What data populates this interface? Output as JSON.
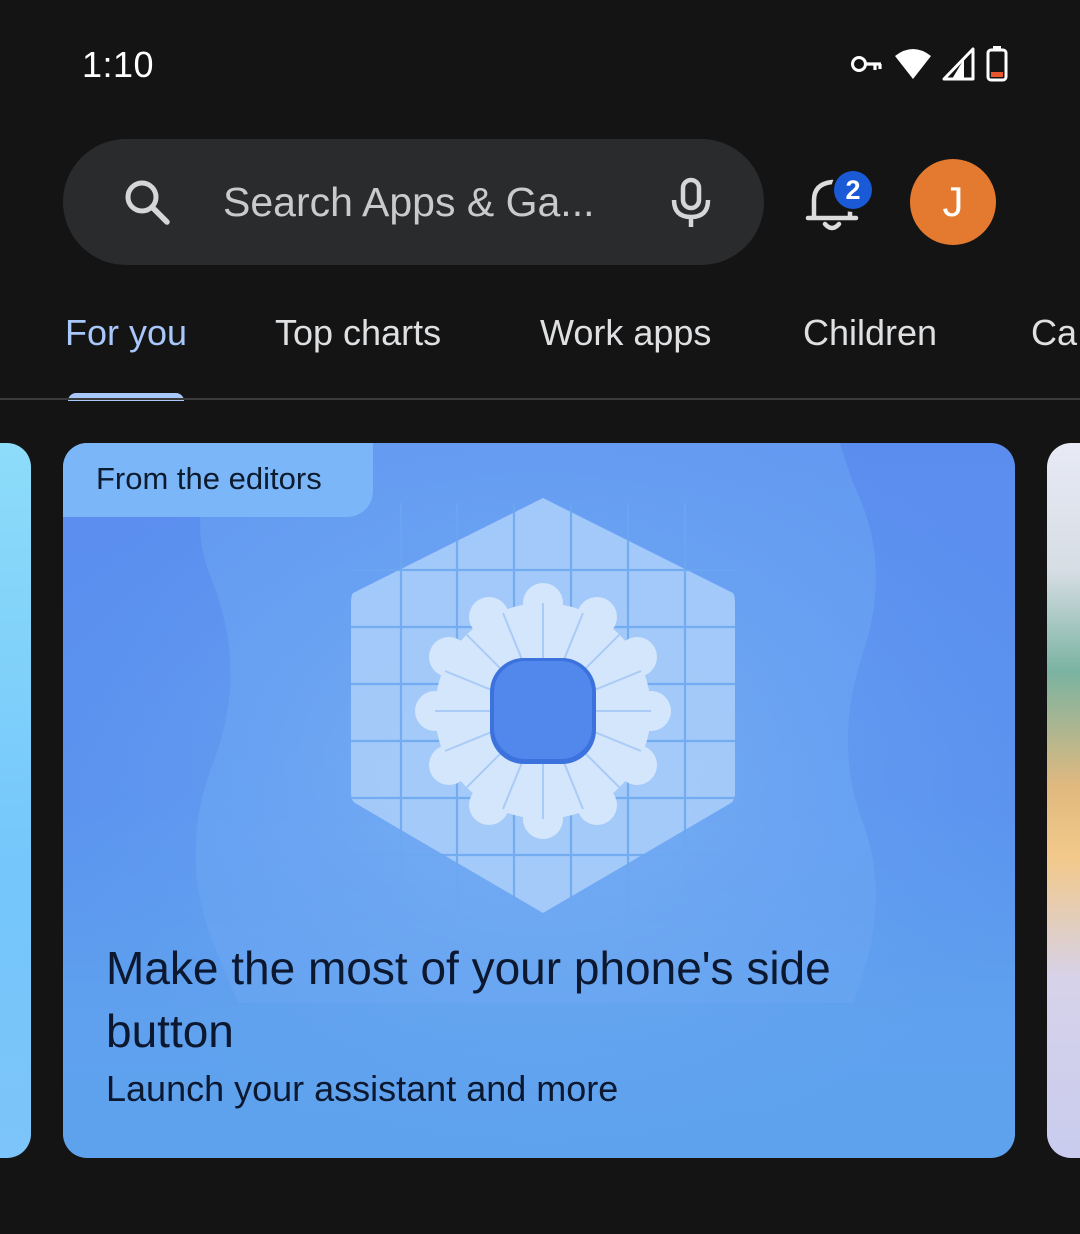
{
  "status_bar": {
    "time": "1:10",
    "icons": [
      "vpn-key-icon",
      "wifi-icon",
      "cell-signal-icon",
      "battery-icon"
    ]
  },
  "search": {
    "placeholder": "Search Apps & Ga..."
  },
  "notifications": {
    "badge_count": "2"
  },
  "account": {
    "avatar_initial": "J",
    "avatar_color": "#e37a30"
  },
  "tabs": [
    {
      "label": "For you",
      "active": true
    },
    {
      "label": "Top charts",
      "active": false
    },
    {
      "label": "Work apps",
      "active": false
    },
    {
      "label": "Children",
      "active": false
    },
    {
      "label": "Ca",
      "active": false
    }
  ],
  "featured_card": {
    "chip": "From the editors",
    "title": "Make the most of your phone's side button",
    "subtitle": "Launch your assistant and more"
  },
  "colors": {
    "accent": "#a8c7fa",
    "background": "#141414",
    "search_bg": "#2a2b2d",
    "badge": "#1a5ad6",
    "card": "#5b8def"
  }
}
